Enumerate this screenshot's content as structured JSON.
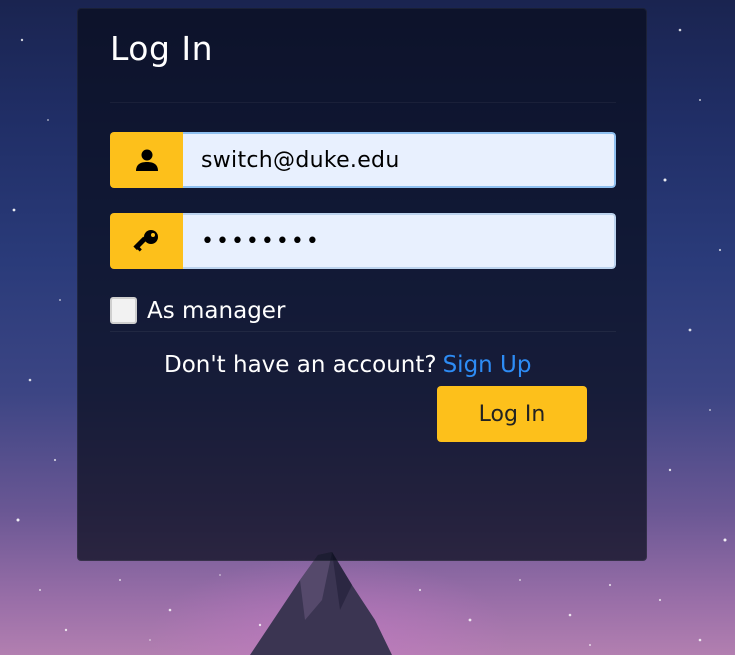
{
  "login": {
    "title": "Log In",
    "email_value": "switch@duke.edu",
    "password_value": "••••••••",
    "manager_checkbox_label": "As manager",
    "manager_checked": false,
    "no_account_text": "Don't have an account?",
    "signup_link": "Sign Up",
    "submit_label": "Log In"
  },
  "icons": {
    "email_addon": "user-icon",
    "password_addon": "key-icon"
  },
  "colors": {
    "accent": "#fdc01b",
    "link": "#2d8cf5",
    "input_bg": "#e8f0fe",
    "panel_bg": "rgba(8, 12, 28, 0.72)"
  }
}
